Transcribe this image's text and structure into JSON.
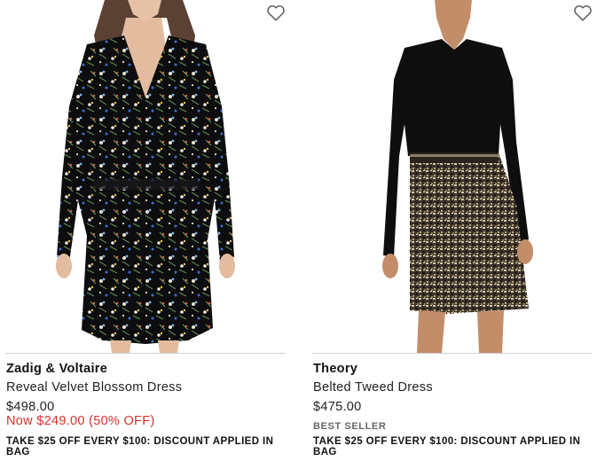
{
  "products": [
    {
      "brand": "Zadig & Voltaire",
      "name": "Reveal Velvet Blossom Dress",
      "price": "$498.00",
      "sale_price": "Now $249.00 (50% OFF)",
      "promo": "TAKE $25 OFF EVERY $100: DISCOUNT APPLIED IN BAG",
      "wishlist_icon": "heart-outline-icon",
      "image": "model-floral-velvet-dress"
    },
    {
      "brand": "Theory",
      "name": "Belted Tweed Dress",
      "price": "$475.00",
      "badge": "BEST SELLER",
      "promo": "TAKE $25 OFF EVERY $100: DISCOUNT APPLIED IN BAG",
      "wishlist_icon": "heart-outline-icon",
      "image": "model-black-top-tweed-skirt"
    }
  ],
  "colors": {
    "sale": "#d0342c",
    "divider": "#cfcfcf",
    "text": "#1a1a1a"
  }
}
